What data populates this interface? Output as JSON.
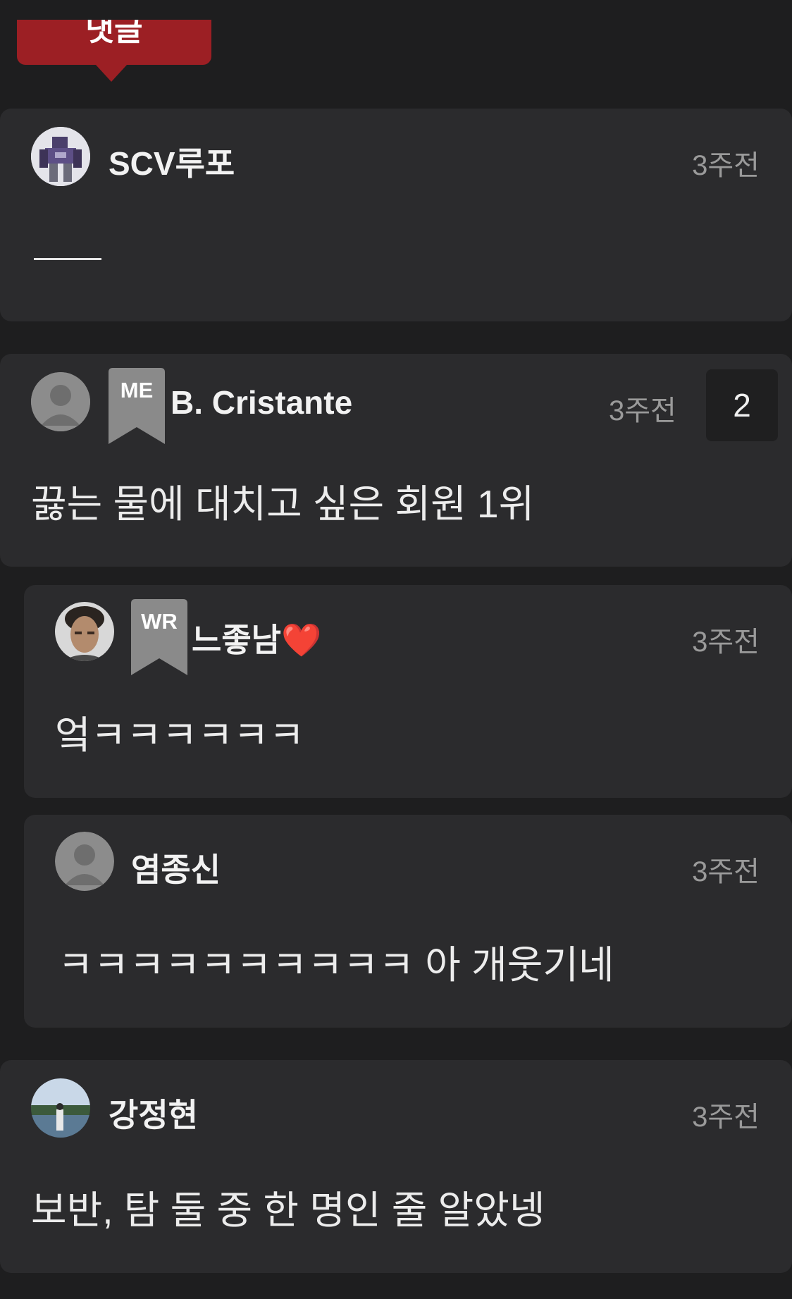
{
  "tab": {
    "label": "댓글"
  },
  "comments": [
    {
      "username": "SCV루포",
      "time": "3주전",
      "text": "ㅡㅡ",
      "avatar": "robot-avatar-icon"
    },
    {
      "username": "B. Cristante",
      "time": "3주전",
      "text": "끓는 물에 대치고 싶은 회원 1위",
      "badge": "ME",
      "reply_count": "2",
      "avatar": "default-user-icon"
    },
    {
      "username": "느좋남❤️",
      "time": "3주전",
      "text": "엌ㅋㅋㅋㅋㅋㅋ",
      "badge": "WR",
      "avatar": "person-photo-avatar"
    },
    {
      "username": "염종신",
      "time": "3주전",
      "text": "ㅋㅋㅋㅋㅋㅋㅋㅋㅋㅋ 아 개웃기네",
      "avatar": "default-user-icon"
    },
    {
      "username": "강정현",
      "time": "3주전",
      "text": "보반, 탐 둘 중 한 명인 줄 알았넹",
      "avatar": "landscape-photo-avatar"
    }
  ],
  "colors": {
    "background": "#1e1e1f",
    "card": "#2b2b2d",
    "accent": "#9c1f24",
    "badge": "#8a8a8a",
    "time_text": "#9a9a9a"
  }
}
